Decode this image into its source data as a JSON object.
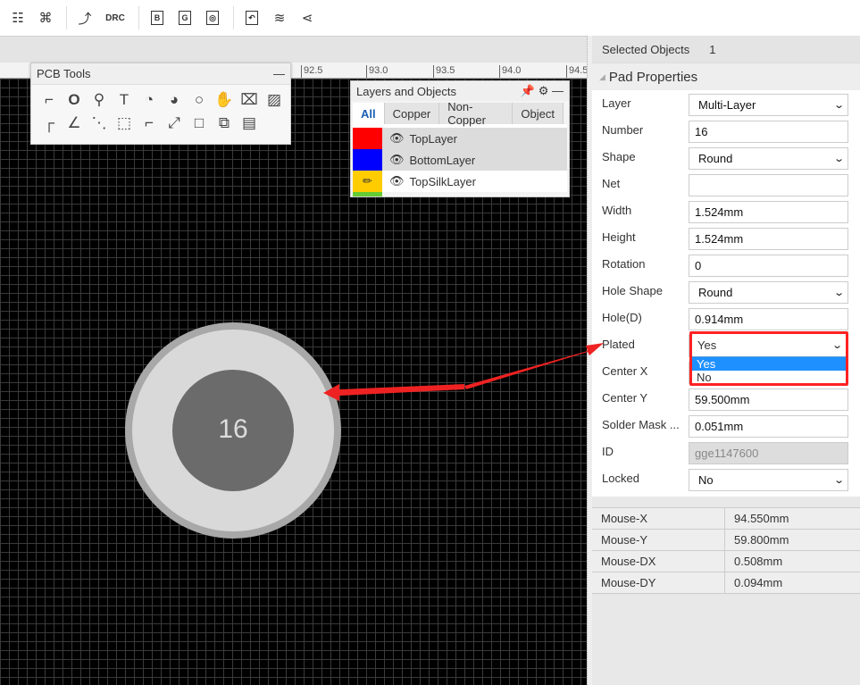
{
  "toolbar": {
    "drc_label": "DRC",
    "b_label": "B",
    "g_label": "G"
  },
  "ruler": {
    "ticks": [
      "92.5",
      "93.0",
      "93.5",
      "94.0",
      "94.5"
    ]
  },
  "pcb_tools": {
    "title": "PCB Tools",
    "minimize": "—"
  },
  "pad": {
    "number": "16",
    "outer_color": "#d9d9d9",
    "inner_color": "#6b6b6b"
  },
  "layers_panel": {
    "title": "Layers and Objects",
    "tabs": [
      "All",
      "Copper",
      "Non-Copper",
      "Object"
    ],
    "active_tab": "All",
    "layers": [
      {
        "name": "TopLayer",
        "color": "#ff0000"
      },
      {
        "name": "BottomLayer",
        "color": "#0000ff"
      },
      {
        "name": "TopSilkLayer",
        "color": "#ffcc00"
      }
    ]
  },
  "panel": {
    "selected_label": "Selected Objects",
    "selected_count": "1",
    "section_title": "Pad Properties",
    "props": [
      {
        "label": "Layer",
        "value": "Multi-Layer",
        "type": "select"
      },
      {
        "label": "Number",
        "value": "16",
        "type": "input"
      },
      {
        "label": "Shape",
        "value": "Round",
        "type": "select"
      },
      {
        "label": "Net",
        "value": "",
        "type": "input"
      },
      {
        "label": "Width",
        "value": "1.524mm",
        "type": "input"
      },
      {
        "label": "Height",
        "value": "1.524mm",
        "type": "input"
      },
      {
        "label": "Rotation",
        "value": "0",
        "type": "input"
      },
      {
        "label": "Hole Shape",
        "value": "Round",
        "type": "select"
      },
      {
        "label": "Hole(D)",
        "value": "0.914mm",
        "type": "input"
      },
      {
        "label": "Plated",
        "value": "Yes",
        "type": "select"
      },
      {
        "label": "Center X",
        "value": "",
        "type": "input"
      },
      {
        "label": "Center Y",
        "value": "59.500mm",
        "type": "input"
      },
      {
        "label": "Solder Mask ...",
        "value": "0.051mm",
        "type": "input"
      },
      {
        "label": "ID",
        "value": "gge1147600",
        "type": "disabled"
      },
      {
        "label": "Locked",
        "value": "No",
        "type": "select"
      }
    ],
    "plated_options": [
      "Yes",
      "No"
    ],
    "mouse": [
      {
        "k": "Mouse-X",
        "v": "94.550mm"
      },
      {
        "k": "Mouse-Y",
        "v": "59.800mm"
      },
      {
        "k": "Mouse-DX",
        "v": "0.508mm"
      },
      {
        "k": "Mouse-DY",
        "v": "0.094mm"
      }
    ]
  },
  "annotation": {
    "arrow_color": "#ee2222",
    "highlight_color": "#ff2222"
  }
}
